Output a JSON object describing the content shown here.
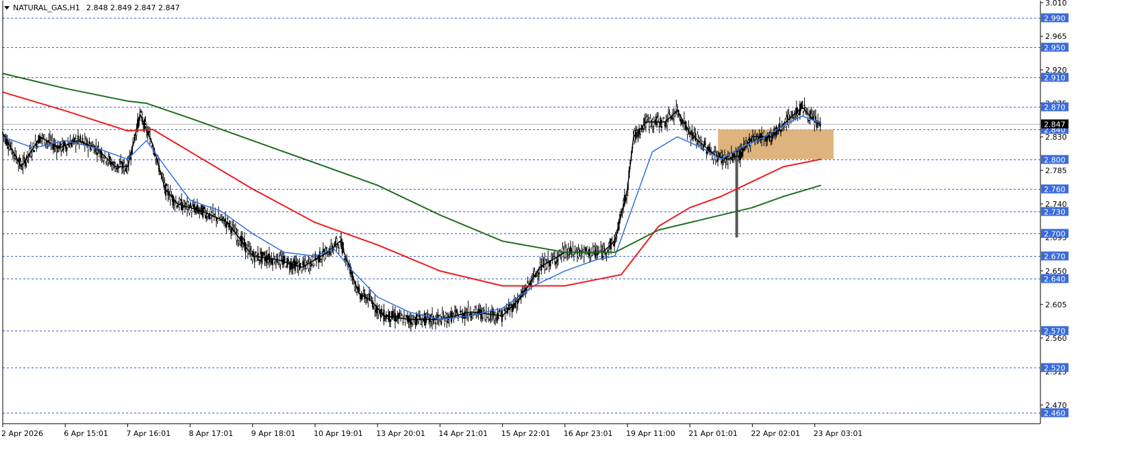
{
  "header": {
    "symbol": "NATURAL_GAS,H1",
    "ohlc": "2.848 2.849 2.847 2.847"
  },
  "colors": {
    "level_line": "#3a5fcd",
    "level_label_bg": "#3a6bd9",
    "candle": "#000000",
    "ma_black": "#000000",
    "ma_blue": "#2f6fe0",
    "ma_red": "#ee1c1c",
    "ma_green": "#1f6e1f",
    "zone": "#d8a666",
    "current_price_bg": "#000000"
  },
  "chart_data": {
    "type": "line",
    "title": "NATURAL_GAS,H1",
    "xlabel": "",
    "ylabel": "",
    "ylim": [
      2.445,
      3.01
    ],
    "y_ticks": [
      "3.010",
      "2.965",
      "2.920",
      "2.875",
      "2.830",
      "2.785",
      "2.740",
      "2.695",
      "2.650",
      "2.605",
      "2.560",
      "2.515",
      "2.470"
    ],
    "x_ticks": [
      "2 Apr 2026",
      "6 Apr 15:01",
      "7 Apr 16:01",
      "8 Apr 17:01",
      "9 Apr 18:01",
      "10 Apr 19:01",
      "13 Apr 20:01",
      "14 Apr 21:01",
      "15 Apr 22:01",
      "16 Apr 23:01",
      "19 Apr 11:00",
      "21 Apr 01:01",
      "22 Apr 02:01",
      "23 Apr 03:01"
    ],
    "levels": [
      "2.990",
      "2.950",
      "2.910",
      "2.870",
      "2.840",
      "2.800",
      "2.760",
      "2.730",
      "2.700",
      "2.670",
      "2.640",
      "2.570",
      "2.520",
      "2.460"
    ],
    "current_price": "2.847",
    "zone": {
      "from_x": 11.45,
      "to_x": 13.3,
      "low": 2.8,
      "high": 2.84
    },
    "grid": false,
    "series": [
      {
        "x": [
          0,
          0.3,
          0.6,
          0.9,
          1.2,
          1.5,
          1.8,
          2.0,
          2.2,
          2.4,
          2.6,
          2.8,
          3.2,
          3.6,
          4.0,
          4.4,
          4.8,
          5.2,
          5.4,
          5.7,
          5.9,
          6.1,
          6.5,
          7.0,
          7.5,
          8.0,
          8.3,
          8.6,
          8.8,
          9.0,
          9.3,
          9.6,
          9.8,
          10.0,
          10.1,
          10.3,
          10.6,
          10.8,
          11.0,
          11.2,
          11.4,
          11.6,
          11.8,
          12.0,
          12.3,
          12.6,
          12.8,
          13.0,
          13.1
        ],
        "values": [
          2.835,
          2.79,
          2.83,
          2.815,
          2.825,
          2.815,
          2.79,
          2.79,
          2.86,
          2.82,
          2.76,
          2.74,
          2.73,
          2.715,
          2.67,
          2.665,
          2.655,
          2.675,
          2.69,
          2.62,
          2.61,
          2.59,
          2.585,
          2.585,
          2.595,
          2.59,
          2.615,
          2.655,
          2.665,
          2.675,
          2.675,
          2.675,
          2.69,
          2.76,
          2.83,
          2.85,
          2.85,
          2.865,
          2.835,
          2.82,
          2.805,
          2.8,
          2.805,
          2.83,
          2.83,
          2.855,
          2.87,
          2.85,
          2.847
        ]
      },
      {
        "x": [
          0,
          0.5,
          1.0,
          1.5,
          2.0,
          2.3,
          2.6,
          3.0,
          3.5,
          4.0,
          4.5,
          5.0,
          5.3,
          5.6,
          6.0,
          6.5,
          7.0,
          7.5,
          8.0,
          8.5,
          9.0,
          9.5,
          9.8,
          10.1,
          10.4,
          10.8,
          11.2,
          11.5,
          11.8,
          12.2,
          12.6,
          12.8,
          13.1
        ],
        "values": [
          2.83,
          2.815,
          2.825,
          2.815,
          2.8,
          2.825,
          2.79,
          2.745,
          2.73,
          2.7,
          2.675,
          2.67,
          2.68,
          2.65,
          2.615,
          2.595,
          2.585,
          2.59,
          2.6,
          2.63,
          2.65,
          2.665,
          2.67,
          2.74,
          2.81,
          2.83,
          2.815,
          2.8,
          2.815,
          2.83,
          2.85,
          2.858,
          2.848
        ]
      },
      {
        "x": [
          0,
          1.0,
          2.0,
          2.4,
          3.0,
          4.0,
          5.0,
          6.0,
          7.0,
          8.0,
          9.0,
          9.6,
          9.9,
          10.5,
          11.0,
          11.5,
          12.0,
          12.5,
          13.1
        ],
        "values": [
          2.89,
          2.865,
          2.838,
          2.84,
          2.81,
          2.76,
          2.715,
          2.685,
          2.65,
          2.63,
          2.63,
          2.64,
          2.645,
          2.71,
          2.735,
          2.75,
          2.77,
          2.79,
          2.8
        ]
      },
      {
        "x": [
          0,
          1.0,
          2.0,
          2.3,
          3.0,
          4.0,
          5.0,
          6.0,
          7.0,
          8.0,
          9.0,
          9.8,
          10.5,
          11.0,
          11.5,
          12.0,
          12.5,
          13.1
        ],
        "values": [
          2.915,
          2.895,
          2.878,
          2.875,
          2.855,
          2.825,
          2.795,
          2.765,
          2.725,
          2.69,
          2.675,
          2.675,
          2.705,
          2.715,
          2.725,
          2.735,
          2.75,
          2.765
        ]
      }
    ]
  }
}
